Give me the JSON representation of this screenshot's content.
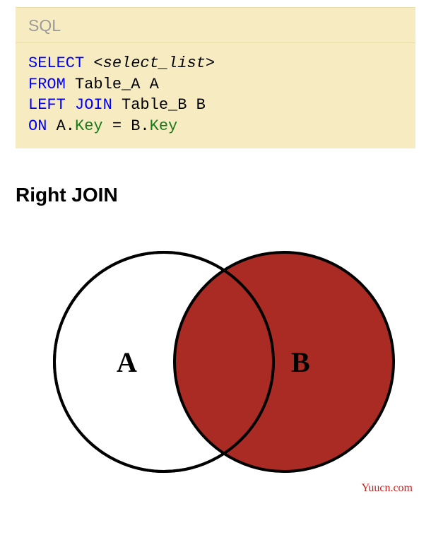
{
  "codeBlock": {
    "language": "SQL",
    "tokens": {
      "select": "SELECT",
      "selectList": "<select_list>",
      "from": "FROM",
      "tableA": "Table_A A",
      "leftJoin": "LEFT JOIN",
      "tableB": "Table_B B",
      "on": "ON",
      "aDot": "A.",
      "keyA": "Key",
      "equals": " = ",
      "bDot": "B.",
      "keyB": "Key"
    }
  },
  "heading": "Right JOIN",
  "venn": {
    "labelA": "A",
    "labelB": "B",
    "circleAColor": "#ffffff",
    "circleBColor": "#aa2b24",
    "strokeColor": "#000000"
  },
  "watermark": "Yuucn.com"
}
